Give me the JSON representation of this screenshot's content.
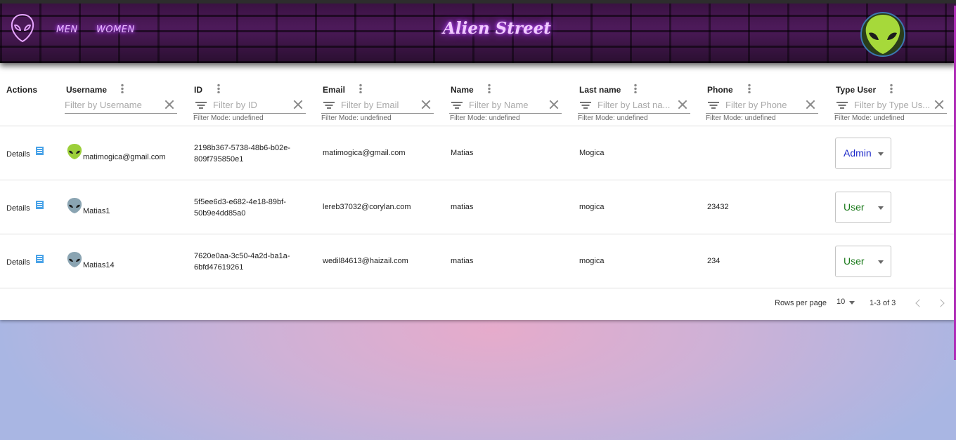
{
  "nav": {
    "links": [
      "MEN",
      "WOMEN"
    ],
    "brand": "Alien Street",
    "logo_icon": "alien-head-outline-icon",
    "avatar_icon": "alien-avatar-icon",
    "accent_color": "#c25cff"
  },
  "table": {
    "columns": [
      {
        "title": "Actions"
      },
      {
        "title": "Username",
        "placeholder": "Filter by Username"
      },
      {
        "title": "ID",
        "placeholder": "Filter by ID",
        "mode": "Filter Mode: undefined"
      },
      {
        "title": "Email",
        "placeholder": "Filter by Email",
        "mode": "Filter Mode: undefined"
      },
      {
        "title": "Name",
        "placeholder": "Filter by Name",
        "mode": "Filter Mode: undefined"
      },
      {
        "title": "Last name",
        "placeholder": "Filter by Last na...",
        "mode": "Filter Mode: undefined"
      },
      {
        "title": "Phone",
        "placeholder": "Filter by Phone",
        "mode": "Filter Mode: undefined"
      },
      {
        "title": "Type User",
        "placeholder": "Filter by Type Us...",
        "mode": "Filter Mode: undefined"
      }
    ],
    "rows": [
      {
        "action": "Details",
        "avatar": "green-alien-avatar",
        "username": "matimogica@gmail.com",
        "id_line1": "2198b367-5738-48b6-b02e-",
        "id_line2": "809f795850e1",
        "email": "matimogica@gmail.com",
        "name": "Matias",
        "last_name": "Mogica",
        "phone": "",
        "type_user": "Admin",
        "type_color": "#1a27c9"
      },
      {
        "action": "Details",
        "avatar": "grey-alien-avatar",
        "username": "Matias1",
        "id_line1": "5f5ee6d3-e682-4e18-89bf-",
        "id_line2": "50b9e4dd85a0",
        "email": "lereb37032@corylan.com",
        "name": "matias",
        "last_name": "mogica",
        "phone": "23432",
        "type_user": "User",
        "type_color": "#1b7a1b"
      },
      {
        "action": "Details",
        "avatar": "grey-alien-avatar",
        "username": "Matias14",
        "id_line1": "7620e0aa-3c50-4a2d-ba1a-",
        "id_line2": "6bfd47619261",
        "email": "wedil84613@haizail.com",
        "name": "matias",
        "last_name": "mogica",
        "phone": "234",
        "type_user": "User",
        "type_color": "#1b7a1b"
      }
    ]
  },
  "pagination": {
    "rows_per_page_label": "Rows per page",
    "rows_per_page": "10",
    "range": "1-3 of 3"
  }
}
